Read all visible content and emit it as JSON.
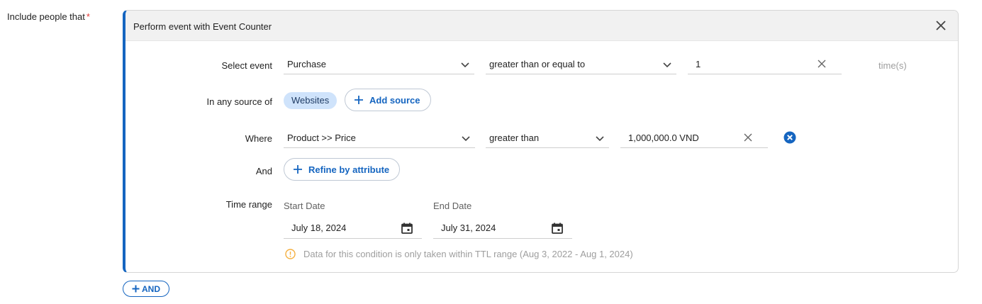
{
  "field": {
    "label": "Include people that",
    "required_mark": "*"
  },
  "condition": {
    "title": "Perform event with Event Counter",
    "select_event": {
      "label": "Select event",
      "event": "Purchase",
      "operator": "greater than or equal to",
      "count": "1",
      "unit": "time(s)"
    },
    "source": {
      "label": "In any source of",
      "chips": [
        "Websites"
      ],
      "add_label": "Add source"
    },
    "where": {
      "label": "Where",
      "attribute": "Product >> Price",
      "operator": "greater than",
      "value": "1,000,000.0 VND"
    },
    "and": {
      "label": "And",
      "refine_label": "Refine by attribute"
    },
    "time_range": {
      "label": "Time range",
      "start_label": "Start Date",
      "start_value": "July 18, 2024",
      "end_label": "End Date",
      "end_value": "July 31, 2024",
      "note": "Data for this condition is only taken within TTL range (Aug 3, 2022 - Aug 1, 2024)"
    }
  },
  "add_and_label": "AND",
  "colors": {
    "accent": "#1565c0",
    "chip_bg": "#cfe3fb",
    "required": "#e53935",
    "warning": "#f5b041"
  },
  "icons": [
    "close-icon",
    "chevron-down-icon",
    "clear-icon",
    "plus-icon",
    "remove-circle-icon",
    "calendar-icon",
    "info-icon"
  ]
}
